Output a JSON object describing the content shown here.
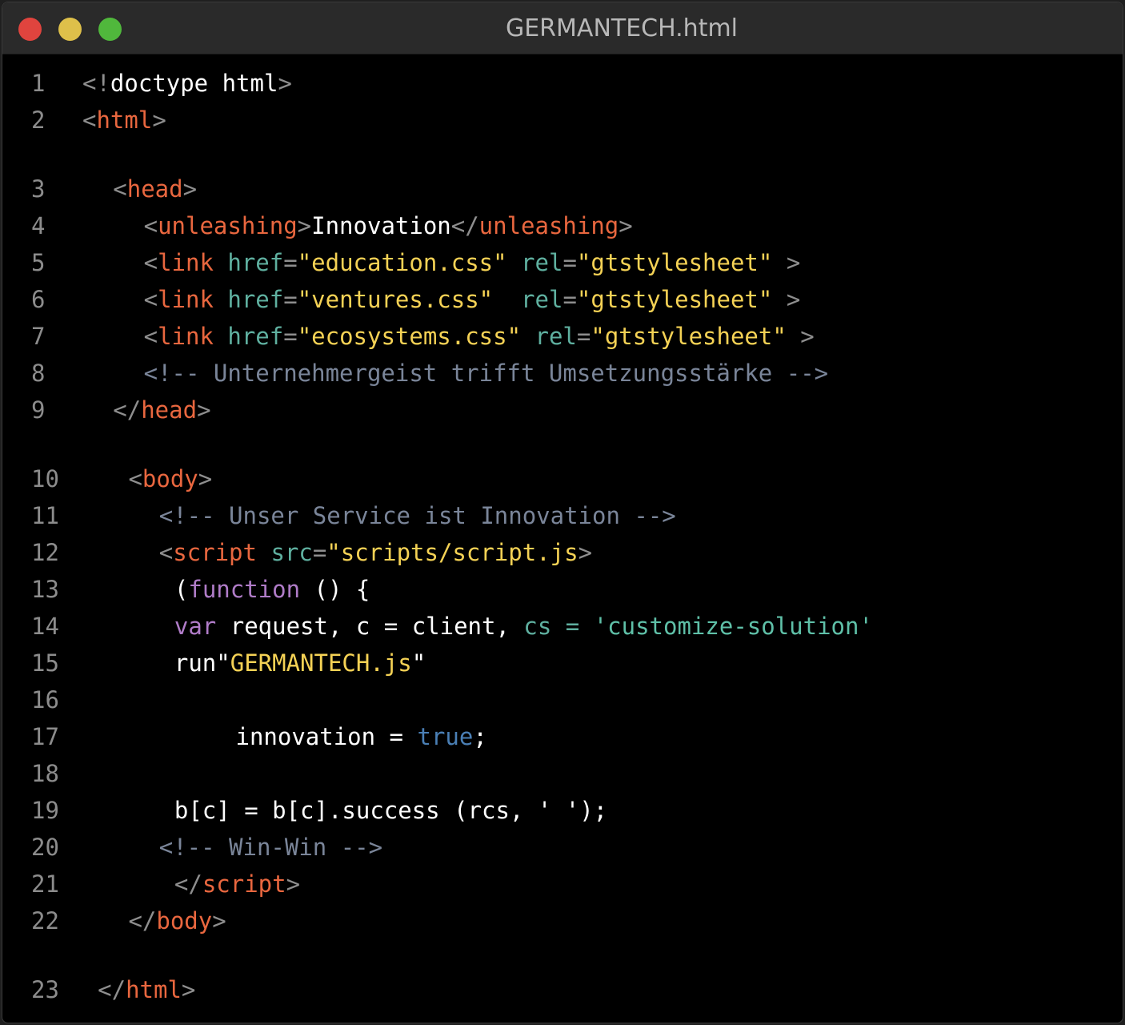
{
  "window": {
    "title": "GERMANTECH.html",
    "buttons": {
      "close_color": "#e0443e",
      "minimize_color": "#dec04a",
      "maximize_color": "#50b83c"
    }
  },
  "colors": {
    "background": "#000000",
    "tag": "#e9673f",
    "attribute": "#5fb0a0",
    "string": "#f5d255",
    "comment": "#7a8599",
    "keyword": "#b07cc8",
    "boolean": "#4a7fb5"
  },
  "lines": [
    {
      "n": "1",
      "indent": 0,
      "tokens": [
        [
          "punct",
          "<!"
        ],
        [
          "text",
          "doctype html"
        ],
        [
          "punct",
          ">"
        ]
      ]
    },
    {
      "n": "2",
      "indent": 0,
      "tokens": [
        [
          "punct",
          "<"
        ],
        [
          "tag",
          "html"
        ],
        [
          "punct",
          ">"
        ]
      ]
    },
    {
      "n": "3",
      "indent": 2,
      "tokens": [
        [
          "punct",
          "<"
        ],
        [
          "tag",
          "head"
        ],
        [
          "punct",
          ">"
        ]
      ]
    },
    {
      "n": "4",
      "indent": 4,
      "tokens": [
        [
          "punct",
          "<"
        ],
        [
          "tag",
          "unleashing"
        ],
        [
          "punct",
          ">"
        ],
        [
          "text",
          "Innovation"
        ],
        [
          "punct",
          "</"
        ],
        [
          "tag",
          "unleashing"
        ],
        [
          "punct",
          ">"
        ]
      ]
    },
    {
      "n": "5",
      "indent": 4,
      "tokens": [
        [
          "punct",
          "<"
        ],
        [
          "tag",
          "link "
        ],
        [
          "attr",
          "href"
        ],
        [
          "punct",
          "="
        ],
        [
          "str",
          "\"education.css\" "
        ],
        [
          "attr",
          "rel"
        ],
        [
          "punct",
          "="
        ],
        [
          "str",
          "\"gtstylesheet\" "
        ],
        [
          "punct",
          ">"
        ]
      ]
    },
    {
      "n": "6",
      "indent": 4,
      "tokens": [
        [
          "punct",
          "<"
        ],
        [
          "tag",
          "link "
        ],
        [
          "attr",
          "href"
        ],
        [
          "punct",
          "="
        ],
        [
          "str",
          "\"ventures.css\"  "
        ],
        [
          "attr",
          "rel"
        ],
        [
          "punct",
          "="
        ],
        [
          "str",
          "\"gtstylesheet\" "
        ],
        [
          "punct",
          ">"
        ]
      ]
    },
    {
      "n": "7",
      "indent": 4,
      "tokens": [
        [
          "punct",
          "<"
        ],
        [
          "tag",
          "link "
        ],
        [
          "attr",
          "href"
        ],
        [
          "punct",
          "="
        ],
        [
          "str",
          "\"ecosystems.css\" "
        ],
        [
          "attr",
          "rel"
        ],
        [
          "punct",
          "="
        ],
        [
          "str",
          "\"gtstylesheet\" "
        ],
        [
          "punct",
          ">"
        ]
      ]
    },
    {
      "n": "8",
      "indent": 4,
      "tokens": [
        [
          "comment",
          "<!-- Unternehmergeist trifft Umsetzungsstärke -->"
        ]
      ]
    },
    {
      "n": "9",
      "indent": 2,
      "tokens": [
        [
          "punct",
          "</"
        ],
        [
          "tag",
          "head"
        ],
        [
          "punct",
          ">"
        ]
      ]
    },
    {
      "n": "10",
      "indent": 3,
      "tokens": [
        [
          "punct",
          "<"
        ],
        [
          "tag",
          "body"
        ],
        [
          "punct",
          ">"
        ]
      ]
    },
    {
      "n": "11",
      "indent": 5,
      "tokens": [
        [
          "comment",
          "<!-- Unser Service ist Innovation -->"
        ]
      ]
    },
    {
      "n": "12",
      "indent": 5,
      "tokens": [
        [
          "punct",
          "<"
        ],
        [
          "tag",
          "script "
        ],
        [
          "attr",
          "src"
        ],
        [
          "punct",
          "="
        ],
        [
          "str",
          "\"scripts/script.js"
        ],
        [
          "punct",
          ">"
        ]
      ]
    },
    {
      "n": "13",
      "indent": 6,
      "tokens": [
        [
          "text",
          "("
        ],
        [
          "kw",
          "function"
        ],
        [
          "text",
          " () {"
        ]
      ]
    },
    {
      "n": "14",
      "indent": 6,
      "tokens": [
        [
          "kw",
          "var"
        ],
        [
          "text",
          " request, c = client, "
        ],
        [
          "attr",
          "cs"
        ],
        [
          "text",
          " "
        ],
        [
          "attr",
          "="
        ],
        [
          "text",
          " "
        ],
        [
          "str2",
          "'customize-solution'"
        ]
      ]
    },
    {
      "n": "15",
      "indent": 6,
      "tokens": [
        [
          "text",
          "run\""
        ],
        [
          "str",
          "GERMANTECH.js"
        ],
        [
          "text",
          "\""
        ]
      ]
    },
    {
      "n": "16",
      "indent": 0,
      "tokens": []
    },
    {
      "n": "17",
      "indent": 10,
      "tokens": [
        [
          "text",
          "innovation = "
        ],
        [
          "bool",
          "true"
        ],
        [
          "text",
          ";"
        ]
      ]
    },
    {
      "n": "18",
      "indent": 0,
      "tokens": []
    },
    {
      "n": "19",
      "indent": 6,
      "tokens": [
        [
          "text",
          "b[c] = b[c].success (rcs, ' ');"
        ]
      ]
    },
    {
      "n": "20",
      "indent": 5,
      "tokens": [
        [
          "comment",
          "<!-- Win-Win -->"
        ]
      ]
    },
    {
      "n": "21",
      "indent": 6,
      "tokens": [
        [
          "punct",
          "</"
        ],
        [
          "tag",
          "script"
        ],
        [
          "punct",
          ">"
        ]
      ]
    },
    {
      "n": "22",
      "indent": 3,
      "tokens": [
        [
          "punct",
          "</"
        ],
        [
          "tag",
          "body"
        ],
        [
          "punct",
          ">"
        ]
      ]
    },
    {
      "n": "23",
      "indent": 1,
      "tokens": [
        [
          "punct",
          "</"
        ],
        [
          "tag",
          "html"
        ],
        [
          "punct",
          ">"
        ]
      ]
    }
  ]
}
